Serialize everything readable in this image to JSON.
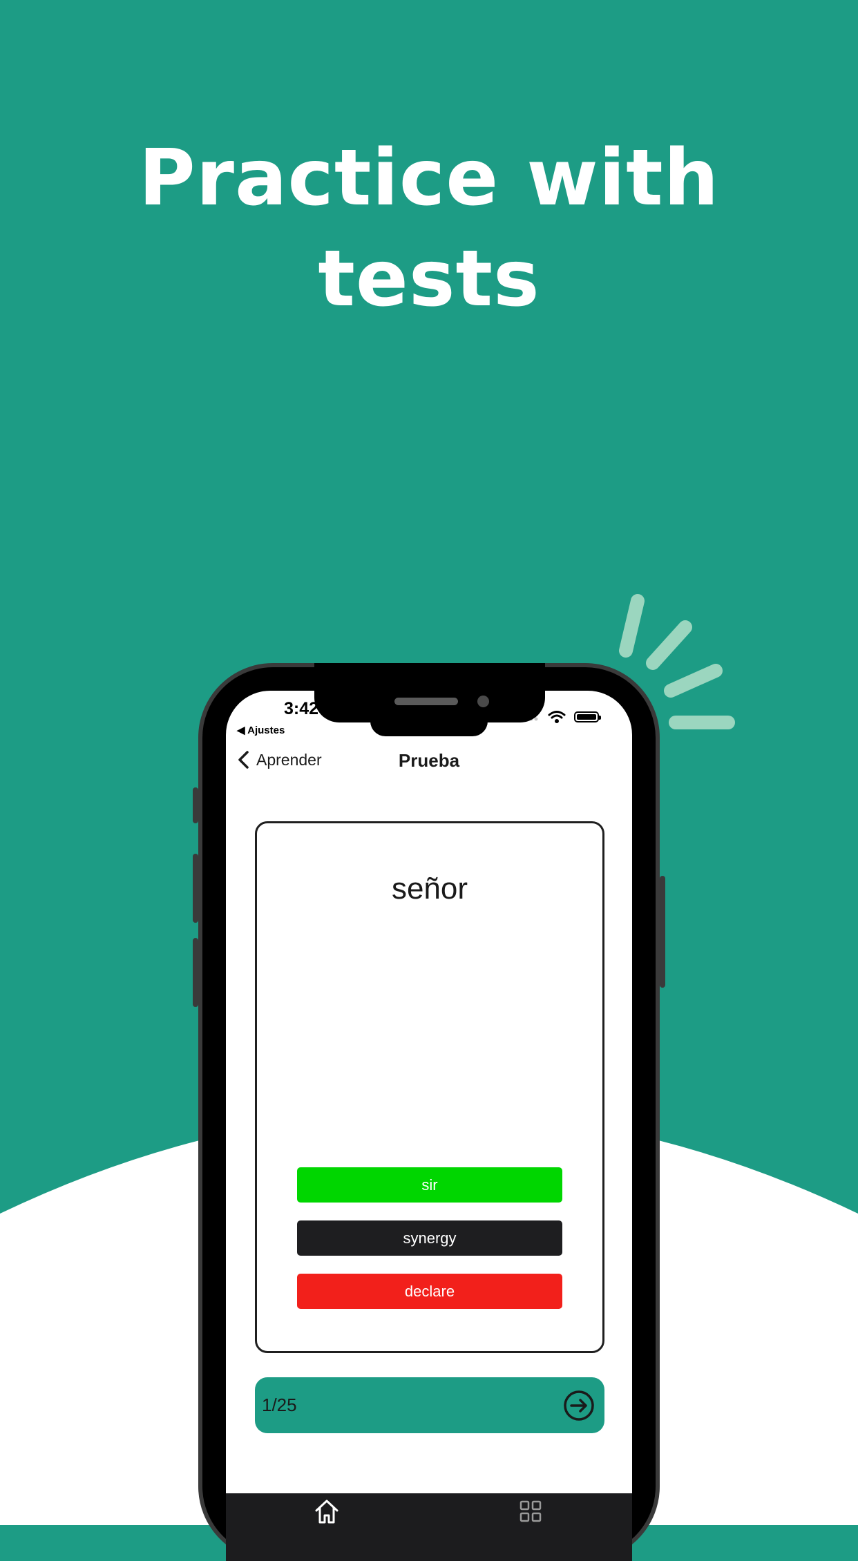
{
  "headline": {
    "line1": "Practice with",
    "line2": "tests"
  },
  "status_bar": {
    "time": "3:42",
    "back_app": "◀ Ajustes",
    "icons": [
      "signal-icon",
      "wifi-icon",
      "battery-icon"
    ]
  },
  "nav": {
    "back_label": "Aprender",
    "title": "Prueba"
  },
  "quiz": {
    "word": "señor",
    "options": [
      {
        "label": "sir",
        "state": "correct",
        "color": "#00d600"
      },
      {
        "label": "synergy",
        "state": "neutral",
        "color": "#1e1e20"
      },
      {
        "label": "declare",
        "state": "wrong",
        "color": "#f2201b"
      }
    ]
  },
  "progress": {
    "count": "1/25",
    "current": 1,
    "total": 25
  },
  "tabbar": {
    "items": [
      {
        "icon": "home-icon",
        "selected": true
      },
      {
        "icon": "grid-icon",
        "selected": false
      }
    ]
  },
  "colors": {
    "brand_green": "#1d9c85",
    "correct": "#00d600",
    "wrong": "#f2201b"
  }
}
